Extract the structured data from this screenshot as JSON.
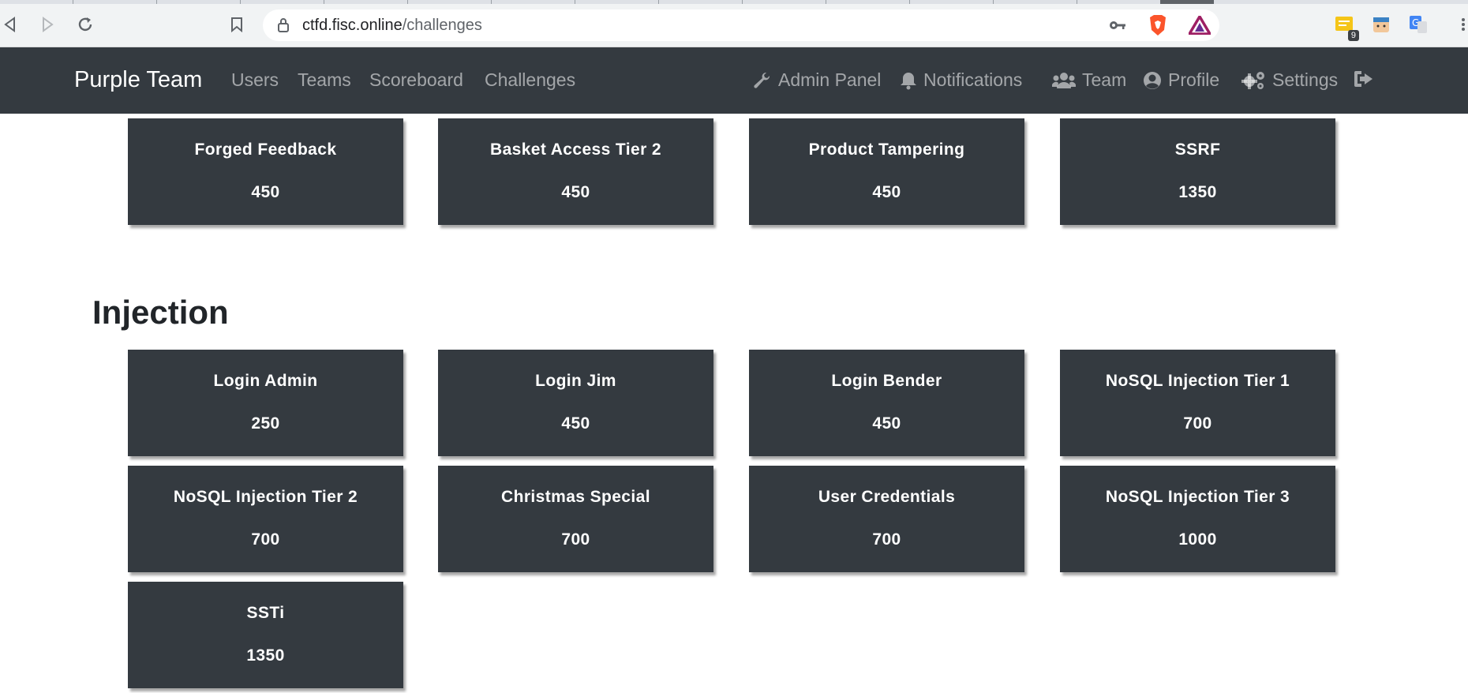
{
  "browser": {
    "url_host": "ctfd.fisc.online",
    "url_path": "/challenges",
    "extension_badge": "9"
  },
  "navbar": {
    "brand": "Purple Team",
    "left_links": [
      "Users",
      "Teams",
      "Scoreboard",
      "Challenges"
    ],
    "right_links": {
      "admin": "Admin Panel",
      "notifications": "Notifications",
      "team": "Team",
      "profile": "Profile",
      "settings": "Settings"
    }
  },
  "top_row": [
    {
      "name": "Forged Feedback",
      "value": "450"
    },
    {
      "name": "Basket Access Tier 2",
      "value": "450"
    },
    {
      "name": "Product Tampering",
      "value": "450"
    },
    {
      "name": "SSRF",
      "value": "1350"
    }
  ],
  "injection": {
    "title": "Injection",
    "challenges": [
      {
        "name": "Login Admin",
        "value": "250"
      },
      {
        "name": "Login Jim",
        "value": "450"
      },
      {
        "name": "Login Bender",
        "value": "450"
      },
      {
        "name": "NoSQL Injection Tier 1",
        "value": "700"
      },
      {
        "name": "NoSQL Injection Tier 2",
        "value": "700"
      },
      {
        "name": "Christmas Special",
        "value": "700"
      },
      {
        "name": "User Credentials",
        "value": "700"
      },
      {
        "name": "NoSQL Injection Tier 3",
        "value": "1000"
      },
      {
        "name": "SSTi",
        "value": "1350"
      }
    ]
  },
  "colors": {
    "navbar_bg": "#343a40",
    "card_bg": "#343a40",
    "chrome_bg": "#f1f3f4"
  }
}
